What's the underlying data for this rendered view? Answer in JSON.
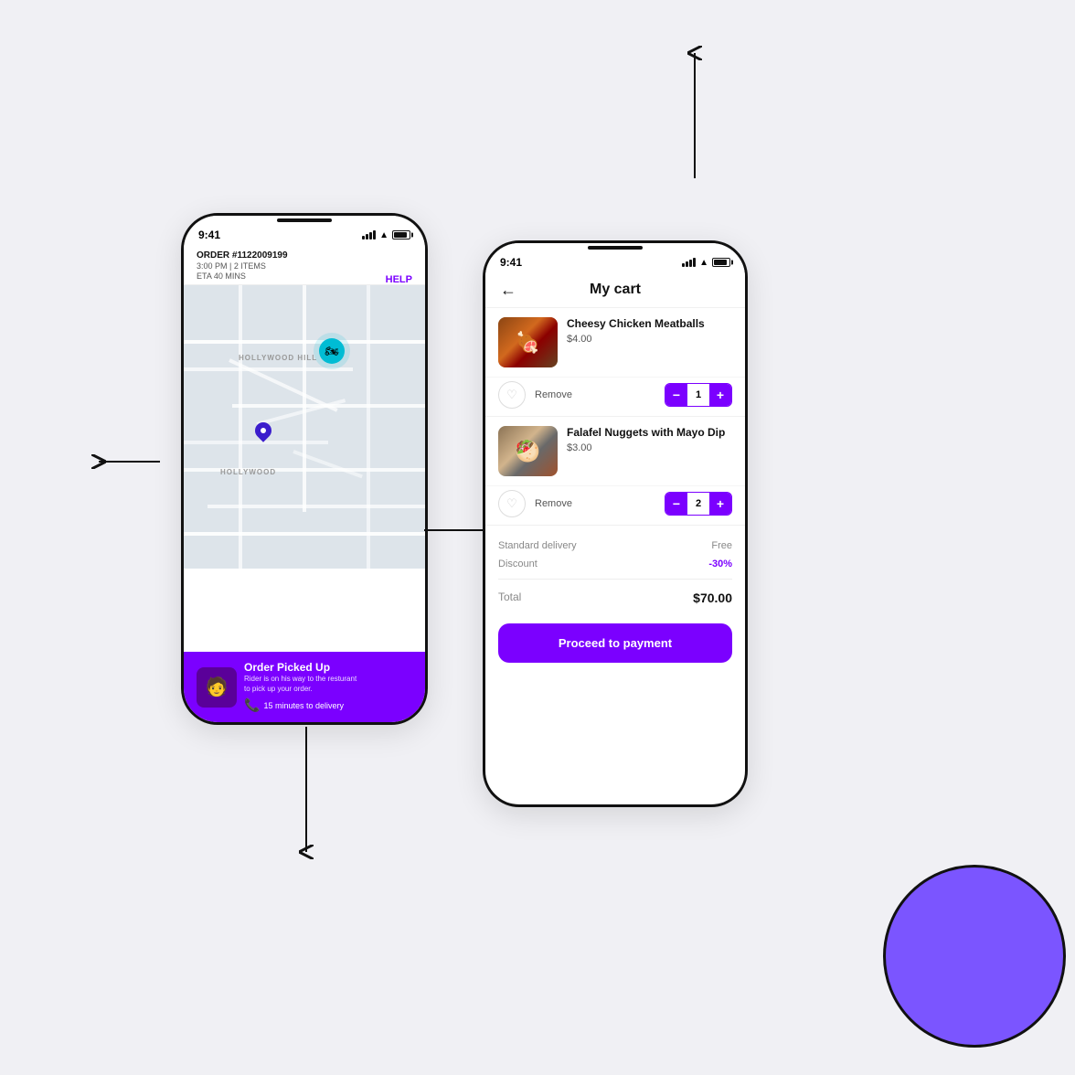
{
  "scene": {
    "background_color": "#f0f0f4"
  },
  "phone1": {
    "status_bar": {
      "time": "9:41"
    },
    "order": {
      "number": "ORDER #1122009199",
      "meta": "3:00 PM | 2 ITEMS",
      "eta": "ETA 40 MINS",
      "help_label": "HELP"
    },
    "map": {
      "label1": "HOLLYWOOD HILL",
      "label2": "HOLLYWOOD"
    },
    "notification": {
      "title": "Order Picked Up",
      "subtitle": "Rider is on his way to the resturant\nto pick up your order.",
      "time": "15 minutes to delivery"
    }
  },
  "phone2": {
    "status_bar": {
      "time": "9:41"
    },
    "header": {
      "title": "My cart",
      "back_label": "←"
    },
    "items": [
      {
        "name": "Cheesy Chicken Meatballs",
        "price": "$4.00",
        "quantity": 1,
        "remove_label": "Remove"
      },
      {
        "name": "Falafel Nuggets with Mayo Dip",
        "price": "$3.00",
        "quantity": 2,
        "remove_label": "Remove"
      }
    ],
    "pricing": {
      "delivery_label": "Standard delivery",
      "delivery_value": "Free",
      "discount_label": "Discount",
      "discount_value": "-30%",
      "total_label": "Total",
      "total_value": "$70.00"
    },
    "proceed_button": "Proceed to payment"
  }
}
